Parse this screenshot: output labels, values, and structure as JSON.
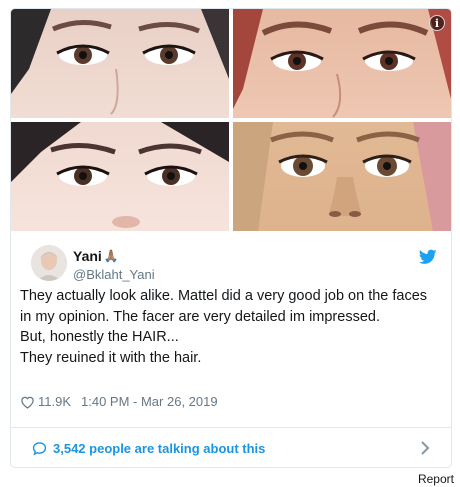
{
  "media": {
    "tiles": [
      "face-photo-1",
      "face-photo-2",
      "face-photo-3",
      "face-photo-4"
    ],
    "info_icon": "info-icon",
    "info_glyph": "i"
  },
  "user": {
    "display_name": "Yani",
    "emoji": "🙏🏽",
    "handle": "@Bklaht_Yani",
    "avatar_icon": "avatar-photo"
  },
  "tweet": {
    "lines": [
      "They actually look alike. Mattel did a very good job on the faces in my opinion. The facer are very detailed im impressed.",
      "But, honestly the HAIR...",
      "They reuined it with the hair."
    ]
  },
  "meta": {
    "likes": "11.9K",
    "timestamp": "1:40 PM - Mar 26, 2019"
  },
  "footer": {
    "talking_text": "3,542 people are talking about this"
  },
  "report_label": "Report",
  "colors": {
    "link": "#1b95e0",
    "muted": "#657786",
    "border": "#e1e8ed",
    "twitter_blue": "#1da1f2"
  }
}
